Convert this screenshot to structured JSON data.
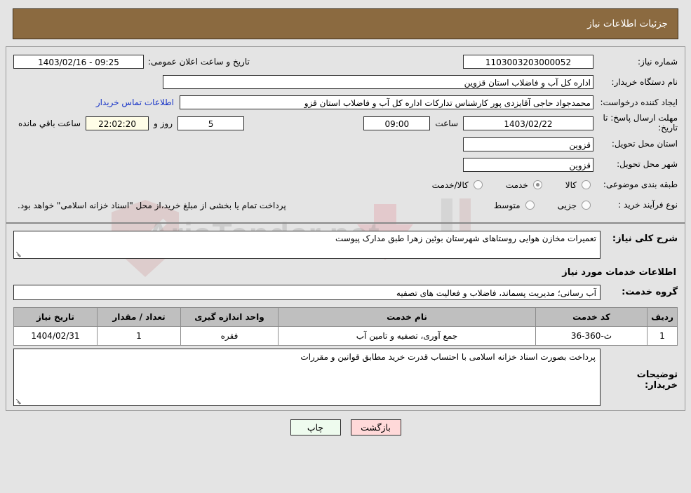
{
  "header": {
    "title": "جزئیات اطلاعات نیاز"
  },
  "form": {
    "need_number_label": "شماره نیاز:",
    "need_number_value": "1103003203000052",
    "public_announce_label": "تاریخ و ساعت اعلان عمومی:",
    "public_announce_value": "09:25 - 1403/02/16",
    "buyer_org_label": "نام دستگاه خریدار:",
    "buyer_org_value": "اداره کل آب و فاضلاب استان قزوین",
    "creator_label": "ایجاد کننده درخواست:",
    "creator_value": "محمدجواد حاجی آقایزدی پور کارشناس تدارکات اداره کل آب و فاضلاب استان قزو",
    "contact_link": "اطلاعات تماس خریدار",
    "deadline_label": "مهلت ارسال پاسخ: تا تاریخ:",
    "deadline_date": "1403/02/22",
    "deadline_hour_label": "ساعت",
    "deadline_hour": "09:00",
    "remaining_days": "5",
    "remaining_days_label": "روز و",
    "remaining_time": "22:02:20",
    "remaining_time_label": "ساعت باقي مانده",
    "province_label": "استان محل تحویل:",
    "province_value": "قزوین",
    "city_label": "شهر محل تحویل:",
    "city_value": "قزوین",
    "classification_label": "طبقه بندی موضوعی:",
    "classification_options": [
      {
        "label": "کالا",
        "selected": false
      },
      {
        "label": "خدمت",
        "selected": true
      },
      {
        "label": "کالا/خدمت",
        "selected": false
      }
    ],
    "process_type_label": "نوع فرآیند خرید :",
    "process_type_options": [
      {
        "label": "جزیی",
        "selected": false
      },
      {
        "label": "متوسط",
        "selected": false
      }
    ],
    "payment_note": "پرداخت تمام یا بخشی از مبلغ خرید،از محل \"اسناد خزانه اسلامی\" خواهد بود."
  },
  "need_summary": {
    "label": "شرح کلی نیاز:",
    "value": "تعمیرات مخازن هوایی روستاهای شهرستان بوئین زهرا طبق مدارک پیوست"
  },
  "services": {
    "section_title": "اطلاعات خدمات مورد نیاز",
    "group_label": "گروه خدمت:",
    "group_value": "آب رسانی؛ مدیریت پسماند، فاضلاب و فعالیت های تصفیه",
    "columns": [
      "ردیف",
      "کد خدمت",
      "نام خدمت",
      "واحد اندازه گیری",
      "تعداد / مقدار",
      "تاریخ نیاز"
    ],
    "rows": [
      {
        "no": "1",
        "code": "ث-360-36",
        "name": "جمع آوری، تصفیه و تامین آب",
        "unit": "فقره",
        "qty": "1",
        "date": "1404/02/31"
      }
    ]
  },
  "buyer_notes": {
    "label": "توضیحات خریدار:",
    "value": "پرداخت بصورت اسناد خزانه اسلامی با احتساب قدرت خرید مطابق قوانین و مقررات"
  },
  "footer": {
    "print_label": "چاپ",
    "back_label": "بازگشت"
  },
  "watermark": {
    "text": "AriaTender.net"
  },
  "colors": {
    "header_bg": "#8b6a40",
    "link": "#1a36c8",
    "print_btn": "#eefbee",
    "back_btn": "#ffd9d9",
    "page_bg": "#e4e4e4"
  }
}
